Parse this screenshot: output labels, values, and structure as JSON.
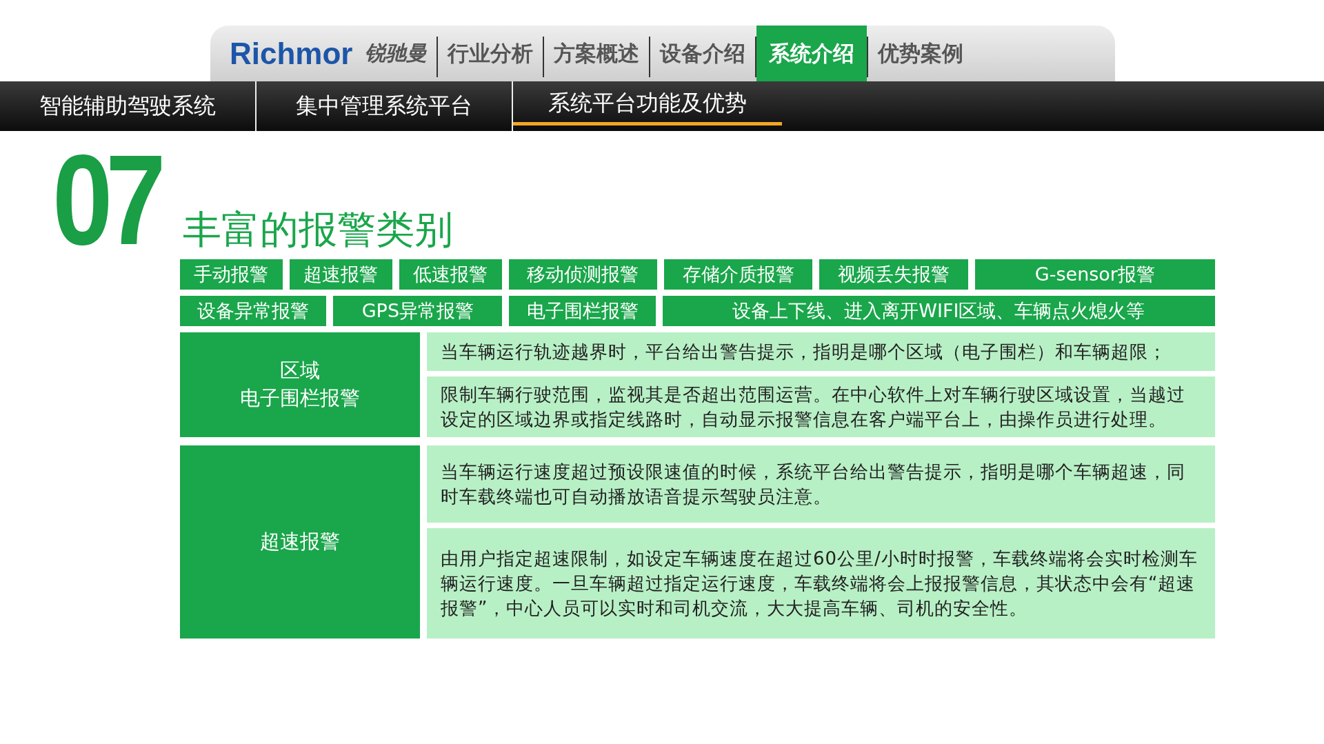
{
  "nav": {
    "logo": {
      "brand": "Richmor",
      "cn": "锐驰曼"
    },
    "items": [
      {
        "label": "行业分析",
        "selected": false
      },
      {
        "label": "方案概述",
        "selected": false
      },
      {
        "label": "设备介绍",
        "selected": false
      },
      {
        "label": "系统介绍",
        "selected": true
      },
      {
        "label": "优势案例",
        "selected": false
      }
    ]
  },
  "subnav": {
    "items": [
      {
        "label": "智能辅助驾驶系统",
        "selected": false
      },
      {
        "label": "集中管理系统平台",
        "selected": false
      },
      {
        "label": "系统平台功能及优势",
        "selected": true
      }
    ]
  },
  "section": {
    "number": "07",
    "title": "丰富的报警类别"
  },
  "tag_rows": [
    [
      "手动报警",
      "超速报警",
      "低速报警",
      "移动侦测报警",
      "存储介质报警",
      "视频丢失报警",
      "G-sensor报警"
    ],
    [
      "设备异常报警",
      "GPS异常报警",
      "电子围栏报警",
      "设备上下线、进入离开WIFI区域、车辆点火熄火等"
    ]
  ],
  "table": [
    {
      "label": [
        "区域",
        "电子围栏报警"
      ],
      "items": [
        "当车辆运行轨迹越界时，平台给出警告提示，指明是哪个区域（电子围栏）和车辆超限；",
        "限制车辆行驶范围，监视其是否超出范围运营。在中心软件上对车辆行驶区域设置，当越过设定的区域边界或指定线路时，自动显示报警信息在客户端平台上，由操作员进行处理。"
      ]
    },
    {
      "label": [
        "超速报警"
      ],
      "items": [
        "当车辆运行速度超过预设限速值的时候，系统平台给出警告提示，指明是哪个车辆超速，同时车载终端也可自动播放语音提示驾驶员注意。",
        "由用户指定超速限制，如设定车辆速度在超过60公里/小时时报警，车载终端将会实时检测车辆运行速度。一旦车辆超过指定运行速度，车载终端将会上报报警信息，其状态中会有“超速报警”，中心人员可以实时和司机交流，大大提高车辆、司机的安全性。"
      ]
    }
  ]
}
